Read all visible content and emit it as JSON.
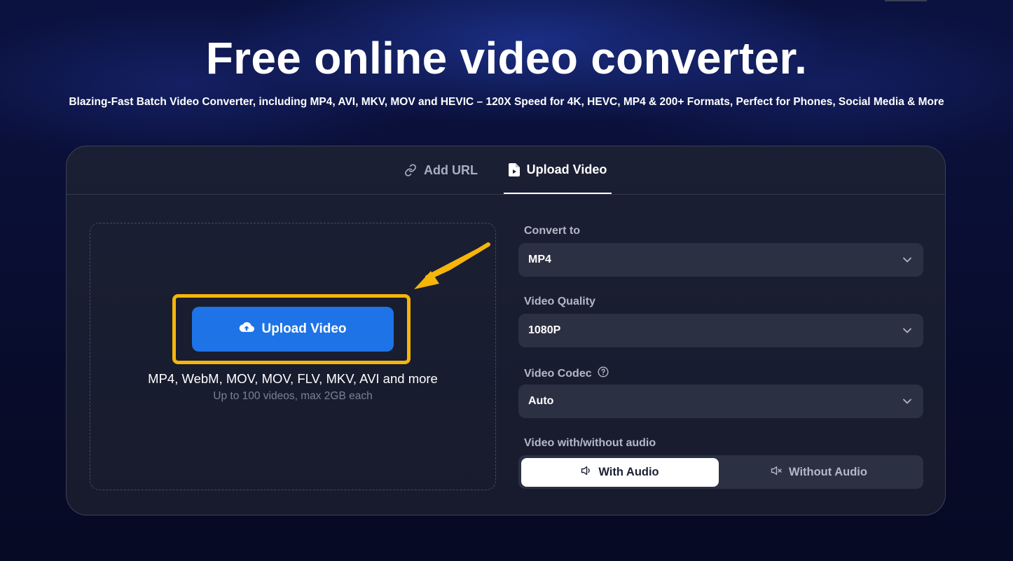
{
  "hero": {
    "title": "Free online video converter.",
    "subtitle": "Blazing-Fast Batch Video Converter, including MP4, AVI, MKV, MOV and HEVIC – 120X Speed for 4K, HEVC, MP4 & 200+ Formats, Perfect for Phones, Social Media & More"
  },
  "tabs": [
    {
      "label": "Add URL",
      "icon": "link-icon",
      "active": false
    },
    {
      "label": "Upload Video",
      "icon": "file-icon",
      "active": true
    }
  ],
  "upload": {
    "button_label": "Upload Video",
    "button_icon": "cloud-upload-icon",
    "formats": "MP4, WebM, MOV, MOV, FLV, MKV, AVI and more",
    "limits": "Up to 100 videos, max 2GB each"
  },
  "settings": {
    "convert_to": {
      "label": "Convert to",
      "value": "MP4"
    },
    "video_quality": {
      "label": "Video Quality",
      "value": "1080P"
    },
    "video_codec": {
      "label": "Video Codec",
      "value": "Auto",
      "help_icon": "question-circle-icon"
    },
    "audio": {
      "label": "Video with/without audio",
      "options": [
        "With Audio",
        "Without Audio"
      ],
      "selected": "With Audio"
    }
  },
  "colors": {
    "accent_blue": "#1e73e6",
    "highlight_yellow": "#f5b50a",
    "card_bg": "#1b1f33",
    "control_bg": "#2c3043"
  }
}
